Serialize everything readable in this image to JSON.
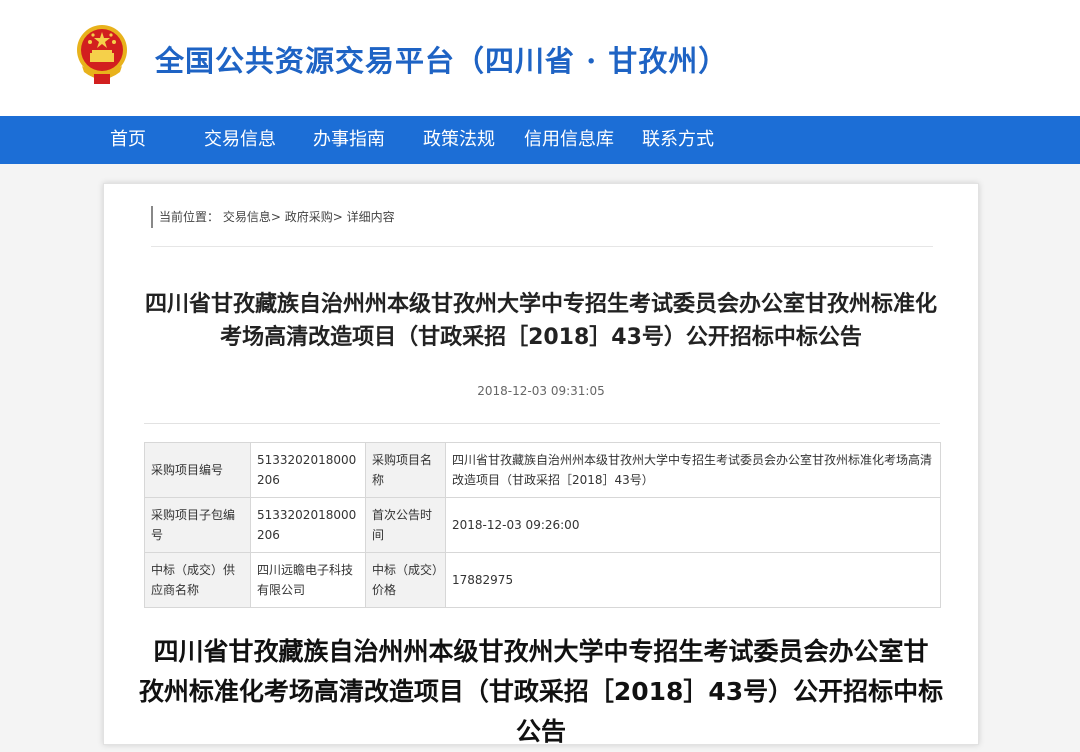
{
  "header": {
    "site_title": "全国公共资源交易平台（四川省 · 甘孜州）"
  },
  "nav": {
    "items": [
      "首页",
      "交易信息",
      "办事指南",
      "政策法规",
      "信用信息库",
      "联系方式"
    ]
  },
  "breadcrumb": {
    "prefix": "当前位置：",
    "items": [
      "交易信息",
      "政府采购",
      "详细内容"
    ],
    "separator": ">"
  },
  "notice": {
    "title_line1": "四川省甘孜藏族自治州州本级甘孜州大学中专招生考试委员会办公室甘孜州标准化",
    "title_line2": "考场高清改造项目（甘政采招［2018］43号）公开招标中标公告",
    "date": "2018-12-03 09:31:05"
  },
  "info_table": {
    "rows": [
      [
        "采购项目编号",
        "5133202018000206",
        "采购项目名称",
        "四川省甘孜藏族自治州州本级甘孜州大学中专招生考试委员会办公室甘孜州标准化考场高清改造项目（甘政采招［2018］43号）"
      ],
      [
        "采购项目子包编号",
        "5133202018000206",
        "首次公告时间",
        "2018-12-03 09:26:00"
      ],
      [
        "中标（成交）供应商名称",
        "四川远瞻电子科技有限公司",
        "中标（成交）价格",
        "17882975"
      ]
    ]
  },
  "body": {
    "title_line1": "四川省甘孜藏族自治州州本级甘孜州大学中专招生考试委员会办公室甘",
    "title_line2": "孜州标准化考场高清改造项目（甘政采招［2018］43号）公开招标中标",
    "title_line3": "公告"
  },
  "colors": {
    "nav_bg": "#1c6ed6",
    "title_blue": "#1e63c4",
    "emblem_red": "#d21f1f",
    "emblem_gold": "#e8b21c"
  },
  "icons": {
    "emblem": "national-emblem-icon"
  }
}
